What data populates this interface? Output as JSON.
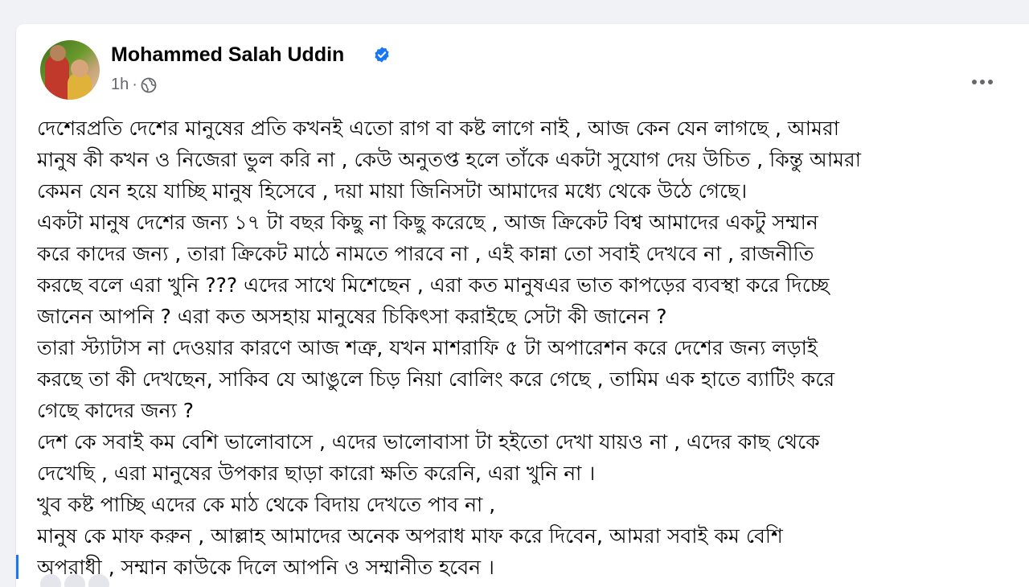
{
  "post": {
    "author": "Mohammed Salah Uddin",
    "time": "1h",
    "separator": "·",
    "privacy_icon": "globe-icon",
    "verified_icon": "verified-badge-icon",
    "more_icon": "more-options-icon",
    "lines": [
      "দেশেরপ্রতি দেশের মানুষের প্রতি কখনই এতো রাগ বা কষ্ট লাগে নাই , আজ কেন যেন লাগছে , আমরা",
      "মানুষ কী কখন ও নিজেরা ভুল করি না , কেউ অনুতপ্ত হলে তাঁকে একটা সুযোগ দেয় উচিত , কিন্তু আমরা",
      "কেমন যেন হয়ে যাচ্ছি মানুষ হিসেবে , দয়া মায়া জিনিসটা আমাদের মধ্যে থেকে উঠে গেছে।",
      "একটা মানুষ দেশের জন্য ১৭ টা বছর কিছু না কিছু করেছে , আজ ক্রিকেট বিশ্ব আমাদের একটু সম্মান",
      "করে কাদের জন্য , তারা ক্রিকেট মাঠে নামতে পারবে না , এই কান্না তো সবাই দেখবে না , রাজনীতি",
      "করছে বলে এরা খুনি ??? এদের সাথে মিশেছেন , এরা কত মানুষএর  ভাত কাপড়ের ব্যবস্থা করে দিচ্ছে",
      "জানেন আপনি ? এরা কত  অসহায় মানুষের চিকিৎসা করাইছে সেটা কী জানেন ?",
      "তারা স্ট্যাটাস না দেওয়ার কারণে আজ শত্রু, যখন মাশরাফি ৫ টা অপারেশন করে দেশের জন্য লড়াই",
      "করছে তা কী দেখছেন, সাকিব যে আঙুলে চিড় নিয়া বোলিং করে গেছে , তামিম এক হাতে ব্যাটিং করে",
      "গেছে কাদের জন্য ?",
      "দেশ কে সবাই কম বেশি ভালোবাসে , এদের ভালোবাসা টা হইতো দেখা যায়ও না , এদের কাছ থেকে",
      "দেখেছি , এরা মানুষের উপকার ছাড়া কারো ক্ষতি করেনি, এরা খুনি না ।",
      "খুব কষ্ট পাচ্ছি এদের কে মাঠ থেকে বিদায় দেখতে পাব না ,",
      "মানুষ কে মাফ করুন , আল্লাহ আমাদের অনেক অপরাধ মাফ করে দিবেন, আমরা সবাই কম বেশি",
      "অপরাধী , সম্মান কাউকে দিলে আপনি ও সম্মানীত হবেন ।"
    ]
  },
  "colors": {
    "background": "#f0f2f5",
    "card": "#ffffff",
    "text": "#050505",
    "secondary_text": "#65676b",
    "verified": "#1877f2"
  }
}
